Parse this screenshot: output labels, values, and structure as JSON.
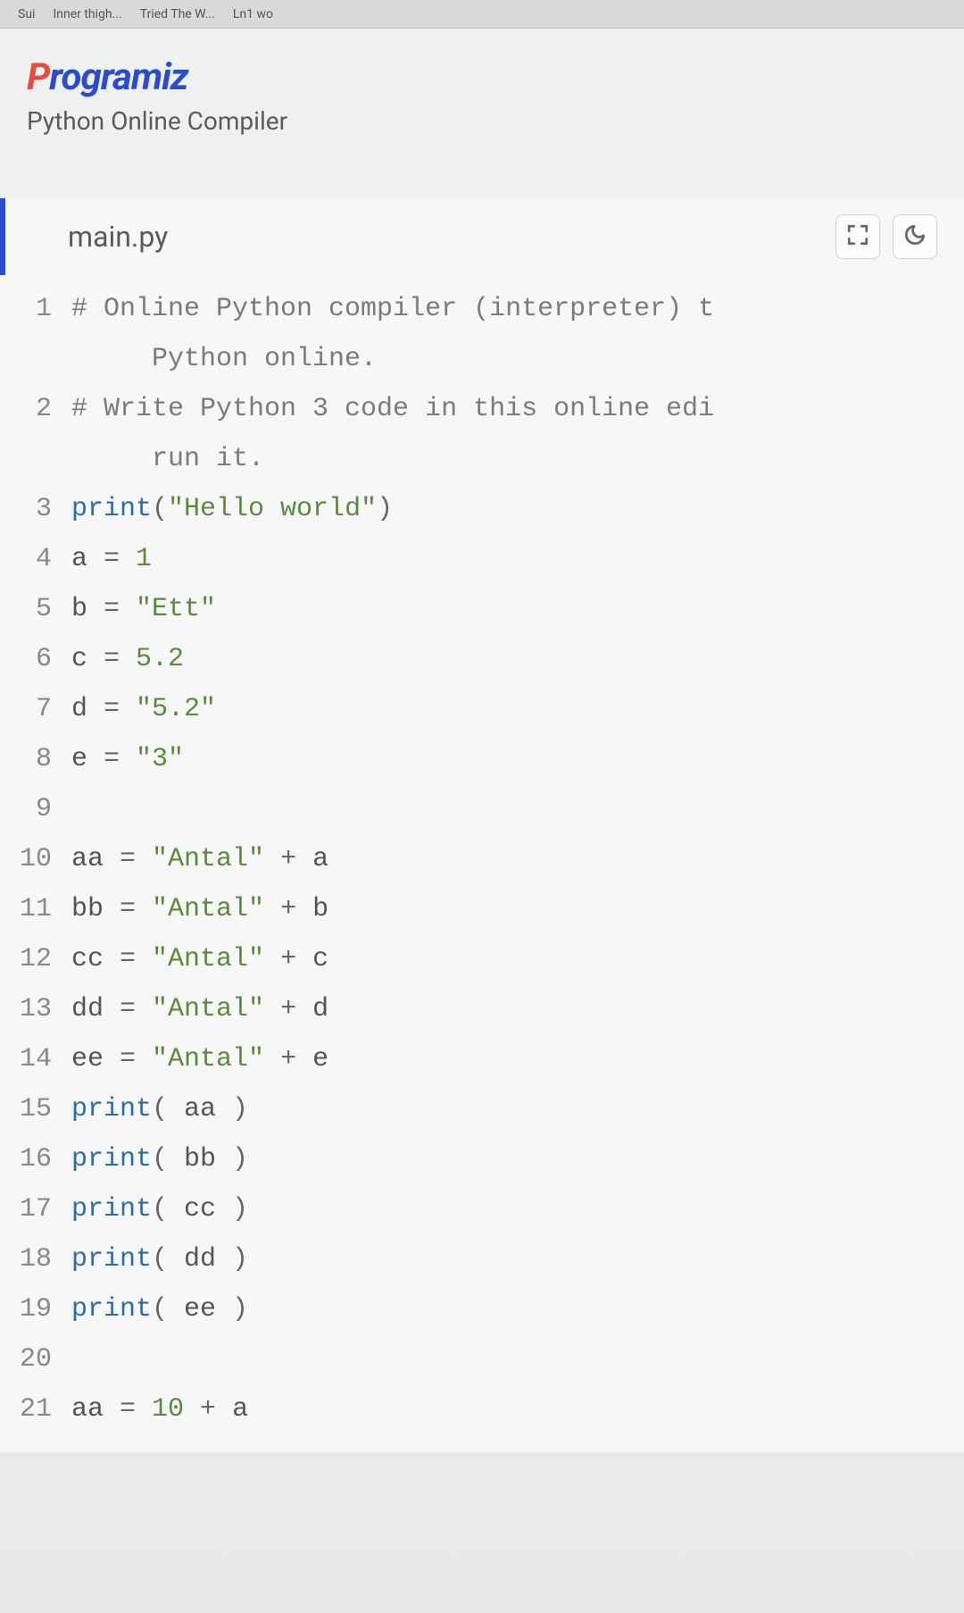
{
  "browser_tabs": [
    "Sui",
    "Inner thigh...",
    "Tried The W...",
    "Ln1 wo"
  ],
  "brand": {
    "logo_p": "P",
    "logo_rest": "rogramiz"
  },
  "subtitle": "Python Online Compiler",
  "filename": "main.py",
  "code": {
    "lines": [
      {
        "n": 1,
        "tokens": [
          {
            "t": "comment",
            "v": "# Online Python compiler (interpreter) t"
          }
        ],
        "wrap": [
          {
            "t": "comment",
            "v": "Python online."
          }
        ]
      },
      {
        "n": 2,
        "tokens": [
          {
            "t": "comment",
            "v": "# Write Python 3 code in this online edi"
          }
        ],
        "wrap": [
          {
            "t": "comment",
            "v": "run it."
          }
        ]
      },
      {
        "n": 3,
        "tokens": [
          {
            "t": "builtin",
            "v": "print"
          },
          {
            "t": "op",
            "v": "("
          },
          {
            "t": "string",
            "v": "\"Hello world\""
          },
          {
            "t": "op",
            "v": ")"
          }
        ]
      },
      {
        "n": 4,
        "tokens": [
          {
            "t": "var",
            "v": "a "
          },
          {
            "t": "op",
            "v": "= "
          },
          {
            "t": "number",
            "v": "1"
          }
        ]
      },
      {
        "n": 5,
        "tokens": [
          {
            "t": "var",
            "v": "b "
          },
          {
            "t": "op",
            "v": "= "
          },
          {
            "t": "string",
            "v": "\"Ett\""
          }
        ]
      },
      {
        "n": 6,
        "tokens": [
          {
            "t": "var",
            "v": "c "
          },
          {
            "t": "op",
            "v": "= "
          },
          {
            "t": "number",
            "v": "5.2"
          }
        ]
      },
      {
        "n": 7,
        "tokens": [
          {
            "t": "var",
            "v": "d "
          },
          {
            "t": "op",
            "v": "= "
          },
          {
            "t": "string",
            "v": "\"5.2\""
          }
        ]
      },
      {
        "n": 8,
        "tokens": [
          {
            "t": "var",
            "v": "e "
          },
          {
            "t": "op",
            "v": "= "
          },
          {
            "t": "string",
            "v": "\"3\""
          }
        ]
      },
      {
        "n": 9,
        "tokens": []
      },
      {
        "n": 10,
        "tokens": [
          {
            "t": "var",
            "v": "aa "
          },
          {
            "t": "op",
            "v": "= "
          },
          {
            "t": "string",
            "v": "\"Antal\""
          },
          {
            "t": "op",
            "v": " + "
          },
          {
            "t": "var",
            "v": "a"
          }
        ]
      },
      {
        "n": 11,
        "tokens": [
          {
            "t": "var",
            "v": "bb "
          },
          {
            "t": "op",
            "v": "= "
          },
          {
            "t": "string",
            "v": "\"Antal\""
          },
          {
            "t": "op",
            "v": " + "
          },
          {
            "t": "var",
            "v": "b"
          }
        ]
      },
      {
        "n": 12,
        "tokens": [
          {
            "t": "var",
            "v": "cc "
          },
          {
            "t": "op",
            "v": "= "
          },
          {
            "t": "string",
            "v": "\"Antal\""
          },
          {
            "t": "op",
            "v": " + "
          },
          {
            "t": "var",
            "v": "c"
          }
        ]
      },
      {
        "n": 13,
        "tokens": [
          {
            "t": "var",
            "v": "dd "
          },
          {
            "t": "op",
            "v": "= "
          },
          {
            "t": "string",
            "v": "\"Antal\""
          },
          {
            "t": "op",
            "v": " + "
          },
          {
            "t": "var",
            "v": "d"
          }
        ]
      },
      {
        "n": 14,
        "tokens": [
          {
            "t": "var",
            "v": "ee "
          },
          {
            "t": "op",
            "v": "= "
          },
          {
            "t": "string",
            "v": "\"Antal\""
          },
          {
            "t": "op",
            "v": " + "
          },
          {
            "t": "var",
            "v": "e"
          }
        ]
      },
      {
        "n": 15,
        "tokens": [
          {
            "t": "builtin",
            "v": "print"
          },
          {
            "t": "op",
            "v": "( "
          },
          {
            "t": "var",
            "v": "aa"
          },
          {
            "t": "op",
            "v": " )"
          }
        ]
      },
      {
        "n": 16,
        "tokens": [
          {
            "t": "builtin",
            "v": "print"
          },
          {
            "t": "op",
            "v": "( "
          },
          {
            "t": "var",
            "v": "bb"
          },
          {
            "t": "op",
            "v": " )"
          }
        ]
      },
      {
        "n": 17,
        "tokens": [
          {
            "t": "builtin",
            "v": "print"
          },
          {
            "t": "op",
            "v": "( "
          },
          {
            "t": "var",
            "v": "cc"
          },
          {
            "t": "op",
            "v": " )"
          }
        ]
      },
      {
        "n": 18,
        "tokens": [
          {
            "t": "builtin",
            "v": "print"
          },
          {
            "t": "op",
            "v": "( "
          },
          {
            "t": "var",
            "v": "dd"
          },
          {
            "t": "op",
            "v": " )"
          }
        ]
      },
      {
        "n": 19,
        "tokens": [
          {
            "t": "builtin",
            "v": "print"
          },
          {
            "t": "op",
            "v": "( "
          },
          {
            "t": "var",
            "v": "ee"
          },
          {
            "t": "op",
            "v": " )"
          }
        ]
      },
      {
        "n": 20,
        "tokens": []
      },
      {
        "n": 21,
        "tokens": [
          {
            "t": "var",
            "v": "aa "
          },
          {
            "t": "op",
            "v": "= "
          },
          {
            "t": "number",
            "v": "10"
          },
          {
            "t": "op",
            "v": " + "
          },
          {
            "t": "var",
            "v": "a"
          }
        ]
      }
    ]
  }
}
